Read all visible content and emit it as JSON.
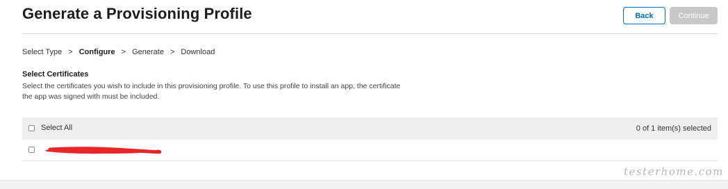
{
  "header": {
    "title": "Generate a Provisioning Profile",
    "back_label": "Back",
    "continue_label": "Continue"
  },
  "breadcrumb": {
    "steps": [
      "Select Type",
      "Configure",
      "Generate",
      "Download"
    ],
    "separator": ">",
    "current_index": 1
  },
  "section": {
    "title": "Select Certificates",
    "description_line1": "Select the certificates you wish to include in this provisioning profile. To use this profile to install an app, the certificate",
    "description_line2": "the app was signed with must be included."
  },
  "table": {
    "select_all_label": "Select All",
    "selection_count": "0 of 1 item(s) selected",
    "rows": [
      {
        "label_redacted": true,
        "checked": false
      }
    ]
  },
  "watermark": "testerhome.com",
  "colors": {
    "accent": "#0070c9",
    "disabled_button": "#c8c8c8",
    "redaction": "#e8262a",
    "header_bg": "#efefef"
  }
}
